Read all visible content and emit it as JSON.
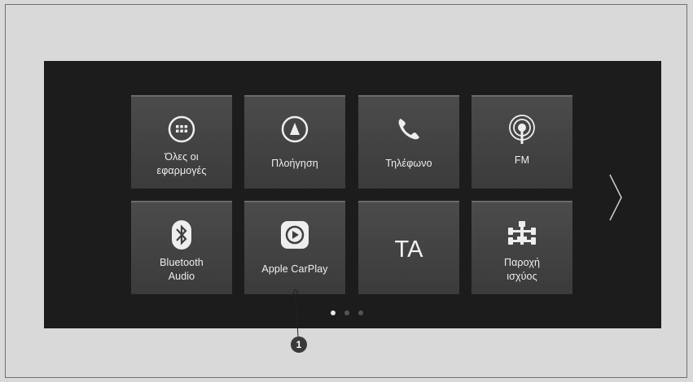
{
  "tiles": [
    {
      "label": "Όλες οι\nεφαρμογές",
      "icon": "apps-grid-icon"
    },
    {
      "label": "Πλοήγηση",
      "icon": "navigation-icon"
    },
    {
      "label": "Τηλέφωνο",
      "icon": "phone-icon"
    },
    {
      "label": "FM",
      "icon": "radio-antenna-icon"
    },
    {
      "label": "Bluetooth\nAudio",
      "icon": "bluetooth-icon"
    },
    {
      "label": "Apple CarPlay",
      "icon": "carplay-icon"
    },
    {
      "label": "TA",
      "icon": ""
    },
    {
      "label": "Παροχή\nισχύος",
      "icon": "power-flow-icon"
    }
  ],
  "pager": {
    "pages": 3,
    "current": 1
  },
  "callout": {
    "number": "1"
  },
  "next_arrow": "chevron-right-icon"
}
